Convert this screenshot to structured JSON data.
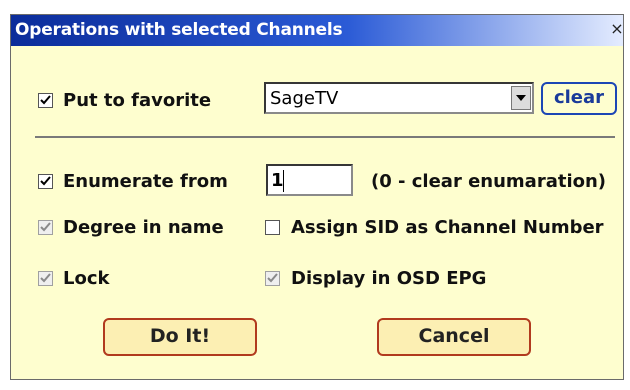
{
  "dialog": {
    "title": "Operations with selected Channels",
    "close_glyph": "×"
  },
  "favorite": {
    "checkbox_label": "Put to favorite",
    "checked": true,
    "select_value": "SageTV",
    "clear_label": "clear"
  },
  "enumerate": {
    "checkbox_label": "Enumerate from",
    "checked": true,
    "value": "1",
    "hint": "(0 - clear enumaration)"
  },
  "options": {
    "degree_label": "Degree in name",
    "degree_checked": true,
    "assign_sid_label": "Assign SID as Channel Number",
    "assign_sid_checked": false,
    "lock_label": "Lock",
    "lock_checked": true,
    "osd_label": "Display in OSD EPG",
    "osd_checked": true
  },
  "buttons": {
    "do_it": "Do It!",
    "cancel": "Cancel"
  },
  "colors": {
    "dialog_bg": "#fefecf",
    "title_gradient_start": "#0b2c9a",
    "button_border": "#b13a1e",
    "clear_border": "#1c46b5"
  }
}
